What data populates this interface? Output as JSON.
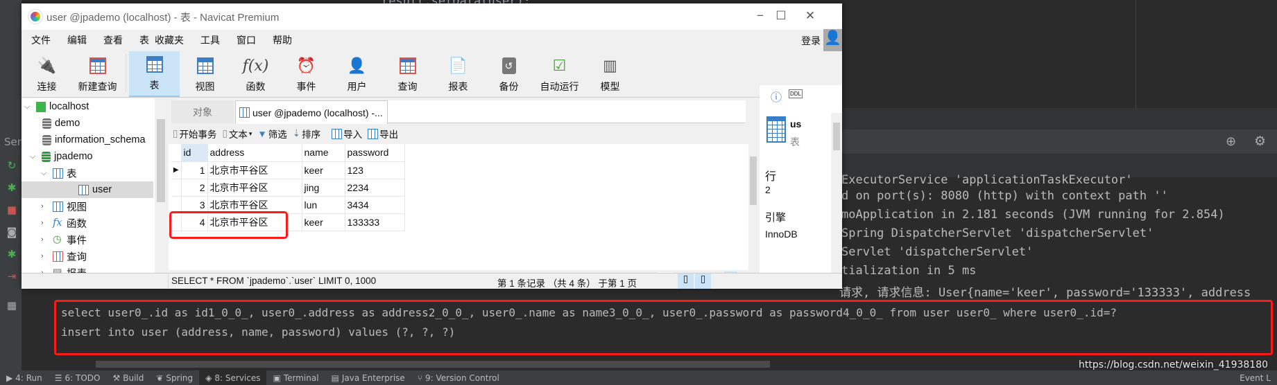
{
  "window": {
    "title": "user @jpademo (localhost) - 表 - Navicat Premium",
    "login": "登录"
  },
  "menu": [
    "文件",
    "编辑",
    "查看",
    "表",
    "收藏夹",
    "工具",
    "窗口",
    "帮助"
  ],
  "toolbar": [
    {
      "label": "连接",
      "icon": "plug-icon"
    },
    {
      "label": "新建查询",
      "icon": "new-query-icon"
    },
    {
      "label": "表",
      "icon": "table-icon",
      "selected": true
    },
    {
      "label": "视图",
      "icon": "view-icon"
    },
    {
      "label": "函数",
      "icon": "function-icon"
    },
    {
      "label": "事件",
      "icon": "alarm-clock-icon"
    },
    {
      "label": "用户",
      "icon": "user-icon"
    },
    {
      "label": "查询",
      "icon": "query-icon"
    },
    {
      "label": "报表",
      "icon": "report-icon"
    },
    {
      "label": "备份",
      "icon": "backup-icon"
    },
    {
      "label": "自动运行",
      "icon": "schedule-icon"
    },
    {
      "label": "模型",
      "icon": "model-icon"
    }
  ],
  "tree": {
    "connection": "localhost",
    "databases": [
      "demo",
      "information_schema",
      "jpademo"
    ],
    "tables_group": "表",
    "selected_table": "user",
    "groups": [
      "视图",
      "函数",
      "事件",
      "查询",
      "报表"
    ]
  },
  "tabs": {
    "objects": "对象",
    "active": "user @jpademo (localhost) -..."
  },
  "data_toolbar": {
    "begin_tx": "开始事务",
    "text": "文本",
    "filter": "筛选",
    "sort": "排序",
    "import": "导入",
    "export": "导出"
  },
  "grid": {
    "columns": [
      "id",
      "address",
      "name",
      "password"
    ],
    "rows": [
      [
        "1",
        "北京市平谷区",
        "keer",
        "123"
      ],
      [
        "2",
        "北京市平谷区",
        "jing",
        "2234"
      ],
      [
        "3",
        "北京市平谷区",
        "lun",
        "3434"
      ],
      [
        "4",
        "北京市平谷区",
        "keer",
        "133333"
      ]
    ],
    "highlighted_row": 4,
    "page": "1"
  },
  "statusbar": {
    "sql": "SELECT * FROM `jpademo`.`user` LIMIT 0, 1000",
    "records": "第 1 条记录 （共 4 条） 于第 1 页"
  },
  "info_panel": {
    "name": "us",
    "type": "表",
    "rows_label": "行",
    "rows": "2",
    "engine_label": "引擎",
    "engine": "InnoDB"
  },
  "ide": {
    "tool_window_label": "Ser",
    "editor_fragment": "result.setData(user);",
    "console_lines": [
      "ExecutorService 'applicationTaskExecutor'",
      "d on port(s): 8080 (http) with context path ''",
      "moApplication in 2.181 seconds (JVM running for 2.854)",
      "Spring DispatcherServlet 'dispatcherServlet'",
      "Servlet 'dispatcherServlet'",
      "tialization in 5 ms",
      "请求, 请求信息: User{name='keer', password='133333', address"
    ],
    "sql_lines": [
      "select user0_.id as id1_0_0_, user0_.address as address2_0_0_, user0_.name as name3_0_0_, user0_.password as password4_0_0_ from user user0_ where user0_.id=?",
      "insert into user (address, name, password) values (?, ?, ?)"
    ],
    "bottom_tabs": [
      "4: Run",
      "6: TODO",
      "Build",
      "Spring",
      "8: Services",
      "Terminal",
      "Java Enterprise",
      "9: Version Control"
    ],
    "active_bottom_tab": "8: Services",
    "event_log": "Event L",
    "watermark": "https://blog.csdn.net/weixin_41938180"
  },
  "colors": {
    "highlight_box": "#ff1a1a",
    "ide_bg": "#2b2b2b",
    "selection": "#cce4f7"
  }
}
